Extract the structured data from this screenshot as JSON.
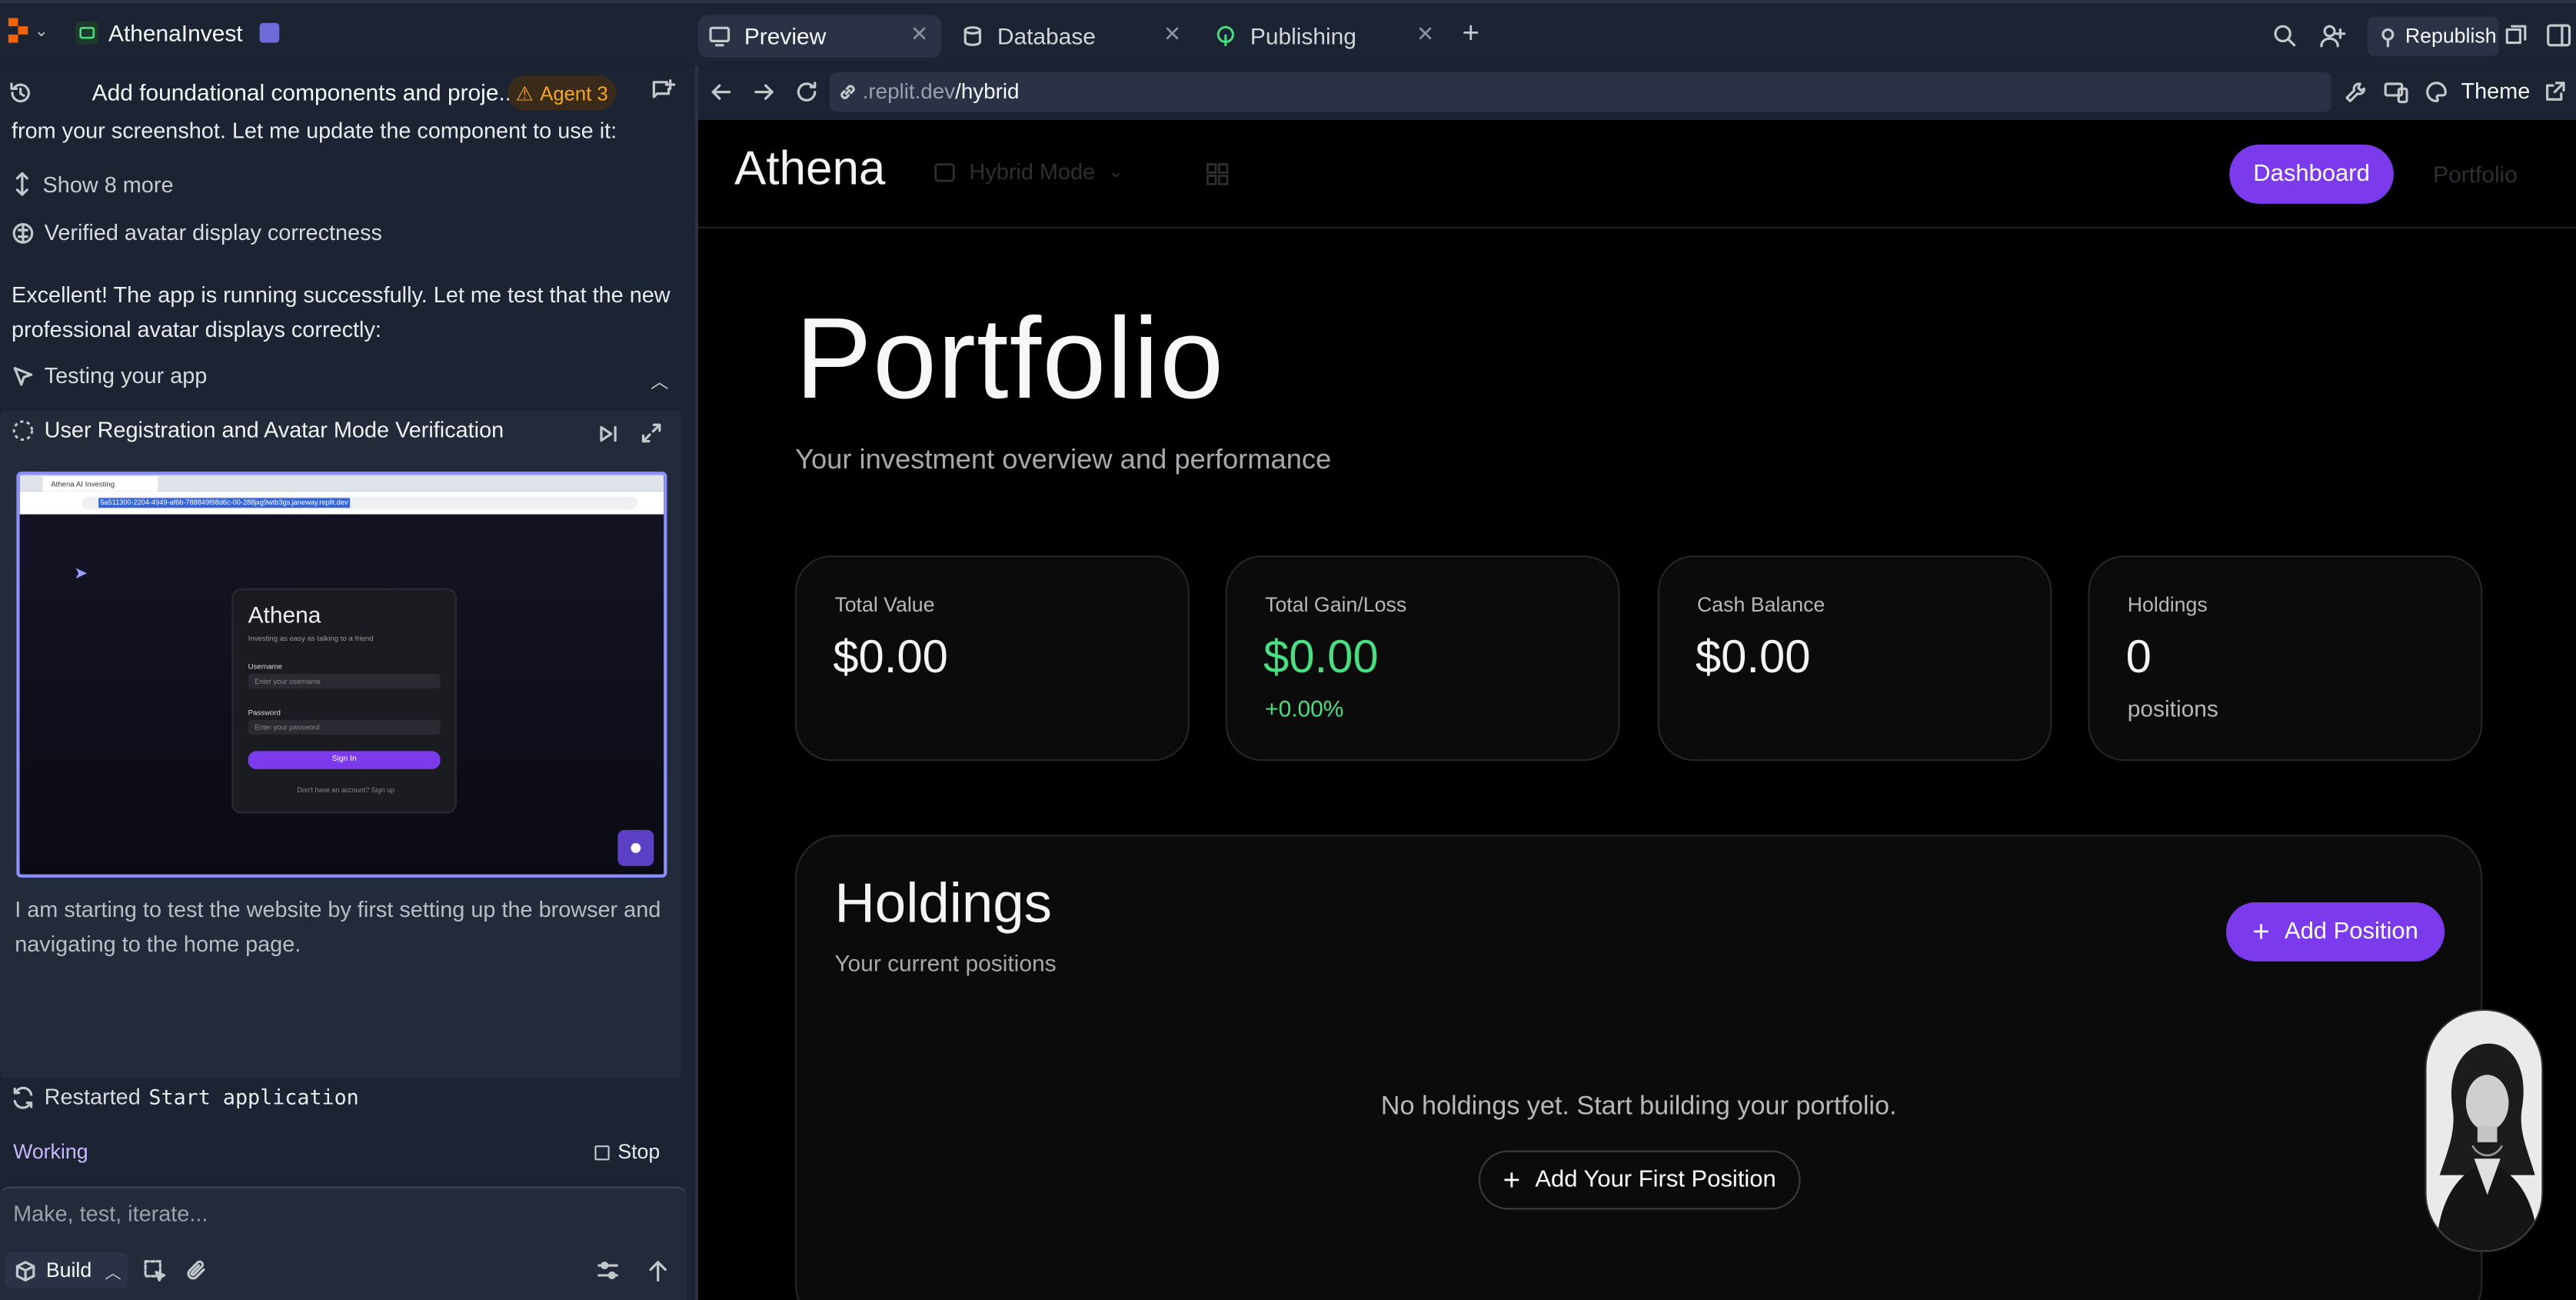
{
  "topbar": {
    "app_name": "AthenaInvest",
    "tabs": [
      {
        "label": "Preview",
        "active": true
      },
      {
        "label": "Database",
        "active": false
      },
      {
        "label": "Publishing",
        "active": false
      }
    ],
    "republish_label": "Republish"
  },
  "agent_panel": {
    "task_title": "Add foundational components and proje...",
    "agent_badge": "Agent 3",
    "messages": [
      "from your screenshot. Let me update the component to use it:",
      "Excellent! The app is running successfully. Let me test that the new professional avatar displays correctly:"
    ],
    "show_more": "Show 8 more",
    "verified": "Verified avatar display correctness",
    "testing_label": "Testing your app",
    "test_title": "User Registration and Avatar Mode Verification",
    "test_description": "I am starting to test the website by first setting up the browser and navigating to the home page.",
    "mini_preview": {
      "tab_title": "Athena AI Investing",
      "url": "5a511300-2204-4949-af6b-788849f98d6c-00-288jxg9wtb3gs.janeway.replit.dev",
      "brand": "Athena",
      "tagline": "Investing as easy as talking to a friend",
      "username_label": "Username",
      "username_placeholder": "Enter your username",
      "password_label": "Password",
      "password_placeholder": "Enter your password",
      "signin_label": "Sign In",
      "signup_text": "Don't have an account? Sign up"
    },
    "restarted_prefix": "Restarted",
    "restarted_name": "Start application",
    "status": "Working",
    "stop_label": "Stop",
    "composer_placeholder": "Make, test, iterate...",
    "build_label": "Build"
  },
  "browser": {
    "url_prefix": ".replit.dev",
    "url_path": "/hybrid",
    "theme_label": "Theme"
  },
  "app": {
    "brand": "Athena",
    "mode_label": "Hybrid Mode",
    "nav": {
      "dashboard": "Dashboard",
      "portfolio": "Portfolio"
    },
    "title": "Portfolio",
    "subtitle": "Your investment overview and performance",
    "stats": [
      {
        "label": "Total Value",
        "value": "$0.00",
        "sub": ""
      },
      {
        "label": "Total Gain/Loss",
        "value": "$0.00",
        "sub": "+0.00%"
      },
      {
        "label": "Cash Balance",
        "value": "$0.00",
        "sub": ""
      },
      {
        "label": "Holdings",
        "value": "0",
        "sub": "positions"
      }
    ],
    "holdings": {
      "title": "Holdings",
      "subtitle": "Your current positions",
      "add_button": "Add Position",
      "empty_text": "No holdings yet. Start building your portfolio.",
      "first_button": "Add Your First Position"
    }
  },
  "colors": {
    "accent": "#7c3aed",
    "positive": "#4ade80",
    "ide_bg": "#1c2333",
    "agent_badge": "#f5a623"
  }
}
